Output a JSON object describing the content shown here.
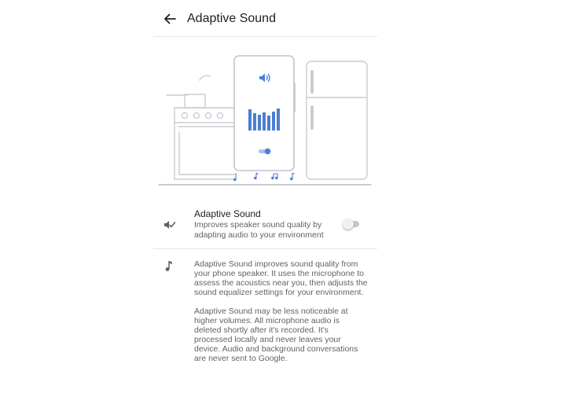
{
  "app_bar": {
    "title": "Adaptive Sound",
    "back_icon": "arrow-back-icon"
  },
  "illustration": {
    "description_icons": [
      "stove-icon",
      "phone-icon",
      "fridge-icon",
      "volume-icon",
      "equalizer-bars",
      "music-note-icon"
    ],
    "accent_color": "#4a7fd4",
    "line_color": "#c9ccd1"
  },
  "setting": {
    "title": "Adaptive Sound",
    "summary": "Improves speaker sound quality by adapting audio to your environment",
    "icon": "adaptive-sound-icon",
    "toggle_on": false
  },
  "info": {
    "icon": "music-note-icon",
    "paragraph1": "Adaptive Sound improves sound quality from your phone speaker. It uses the microphone to assess the acoustics near you, then adjusts the sound equalizer settings for your environment.",
    "paragraph2": "Adaptive Sound may be less noticeable at higher volumes. All microphone audio is deleted shortly after it's recorded. It's processed locally and never leaves your device. Audio and background conversations are never sent to Google."
  },
  "colors": {
    "accent": "#4a7fd4",
    "text_primary": "#202124",
    "text_secondary": "#5f6368",
    "divider": "#e6e6e6"
  }
}
